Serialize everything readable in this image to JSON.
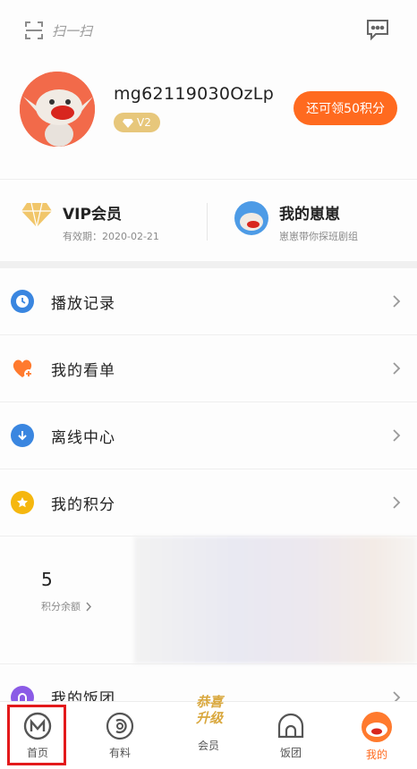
{
  "topbar": {
    "scan_label": "扫一扫"
  },
  "profile": {
    "username": "mg62119030OzLp",
    "level_badge": "V2",
    "points_button": "还可领50积分"
  },
  "vip": {
    "title": "VIP会员",
    "subtitle": "有效期：2020-02-21"
  },
  "xixi": {
    "title": "我的崽崽",
    "subtitle": "崽崽带你探班剧组"
  },
  "menu": [
    {
      "label": "播放记录",
      "icon": "clock-icon",
      "color": "#3a86e0"
    },
    {
      "label": "我的看单",
      "icon": "heart-plus-icon",
      "color": "#ff7a2e"
    },
    {
      "label": "离线中心",
      "icon": "download-icon",
      "color": "#3a86e0"
    },
    {
      "label": "我的积分",
      "icon": "star-coin-icon",
      "color": "#f5b70f"
    }
  ],
  "points": {
    "value": "5",
    "label": "积分余额"
  },
  "fantuan": {
    "label": "我的饭团"
  },
  "tabs": [
    {
      "label": "首页"
    },
    {
      "label": "有料"
    },
    {
      "label": "会员"
    },
    {
      "label": "饭团"
    },
    {
      "label": "我的"
    }
  ],
  "promo": {
    "line1": "恭喜",
    "line2": "升级"
  },
  "colors": {
    "accent": "#ff6a1f",
    "gold": "#e7c77b",
    "highlight": "#e3191b"
  }
}
